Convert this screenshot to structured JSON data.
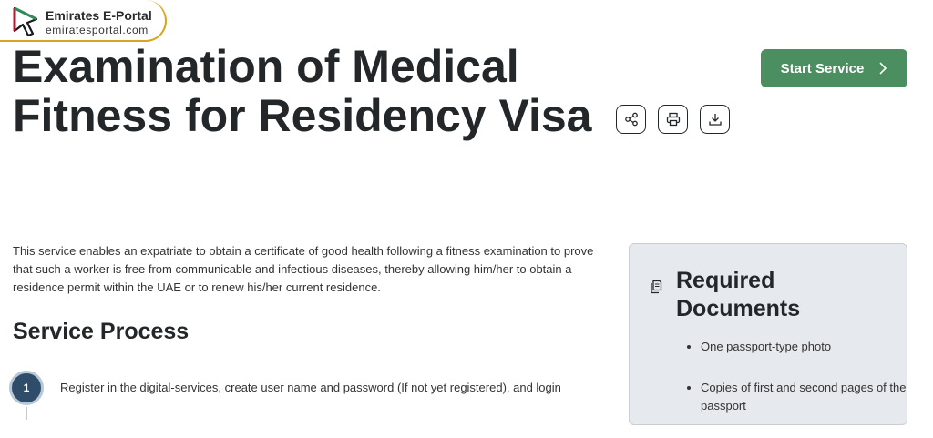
{
  "logo": {
    "name": "Emirates E-Portal",
    "url": "emiratesportal.com"
  },
  "page": {
    "title": "Examination of Medical Fitness for Residency Visa",
    "start_button": "Start Service",
    "description": "This service enables an expatriate to obtain a certificate of good health following a fitness examination to prove that such a worker is free from communicable and infectious diseases, thereby allowing him/her to obtain a residence permit within the UAE or to renew his/her current residence."
  },
  "actions": {
    "share": "share-icon",
    "print": "print-icon",
    "download": "download-icon"
  },
  "process": {
    "title": "Service Process",
    "steps": [
      {
        "number": "1",
        "text": "Register in the digital-services, create user name and password (If not yet registered), and login"
      }
    ]
  },
  "documents": {
    "title": "Required Documents",
    "items": [
      "One passport-type photo",
      "Copies of first and second pages of the passport"
    ]
  },
  "colors": {
    "accent": "#4b8e5f",
    "logo_border": "#d9a520",
    "step": "#2f4d6b",
    "panel": "#e6e9ee"
  }
}
